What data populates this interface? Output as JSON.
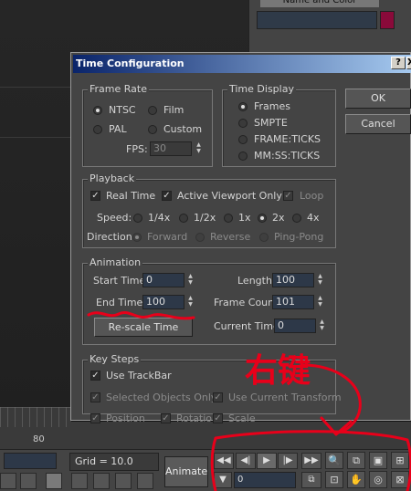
{
  "background": {
    "name_and_color_label": "Name and Color",
    "accent_color": "#8a0a3a",
    "timeline_ruler_label": "80",
    "grid_status": "Grid = 10.0",
    "animate_label": "Animate",
    "current_frame": "0",
    "playback_icons": [
      "go-start-icon",
      "prev-frame-icon",
      "play-icon",
      "next-frame-icon",
      "go-end-icon"
    ],
    "navigation_icons": [
      "zoom-icon",
      "zoom-all-icon",
      "zoom-extents-icon",
      "zoom-extents-all-icon",
      "field-of-view-icon",
      "pan-icon",
      "arc-rotate-icon",
      "maximize-viewport-icon"
    ]
  },
  "dialog": {
    "title": "Time Configuration",
    "help_btn": "?",
    "close_btn": "X",
    "ok_label": "OK",
    "cancel_label": "Cancel",
    "frame_rate": {
      "title": "Frame Rate",
      "options": [
        "NTSC",
        "Film",
        "PAL",
        "Custom"
      ],
      "selected": "NTSC",
      "fps_label": "FPS:",
      "fps_value": "30"
    },
    "time_display": {
      "title": "Time Display",
      "options": [
        "Frames",
        "SMPTE",
        "FRAME:TICKS",
        "MM:SS:TICKS"
      ],
      "selected": "Frames"
    },
    "playback": {
      "title": "Playback",
      "real_time": "Real Time",
      "active_viewport_only": "Active Viewport Only",
      "loop": "Loop",
      "speed_label": "Speed:",
      "speeds": [
        "1/4x",
        "1/2x",
        "1x",
        "2x",
        "4x"
      ],
      "speed_selected": "2x",
      "direction_label": "Direction:",
      "directions": [
        "Forward",
        "Reverse",
        "Ping-Pong"
      ]
    },
    "animation": {
      "title": "Animation",
      "start_time_label": "Start Time:",
      "start_time": "0",
      "end_time_label": "End Time:",
      "end_time": "100",
      "length_label": "Length:",
      "length": "100",
      "frame_count_label": "Frame Count:",
      "frame_count": "101",
      "rescale_label": "Re-scale Time",
      "current_time_label": "Current Time:",
      "current_time": "0"
    },
    "key_steps": {
      "title": "Key Steps",
      "use_trackbar": "Use TrackBar",
      "selected_objects_only": "Selected Objects Only",
      "use_current_transform": "Use Current Transform",
      "position": "Position",
      "rotation": "Rotation",
      "scale": "Scale"
    }
  },
  "annotation": {
    "text": "右键",
    "color": "#e8001a"
  }
}
